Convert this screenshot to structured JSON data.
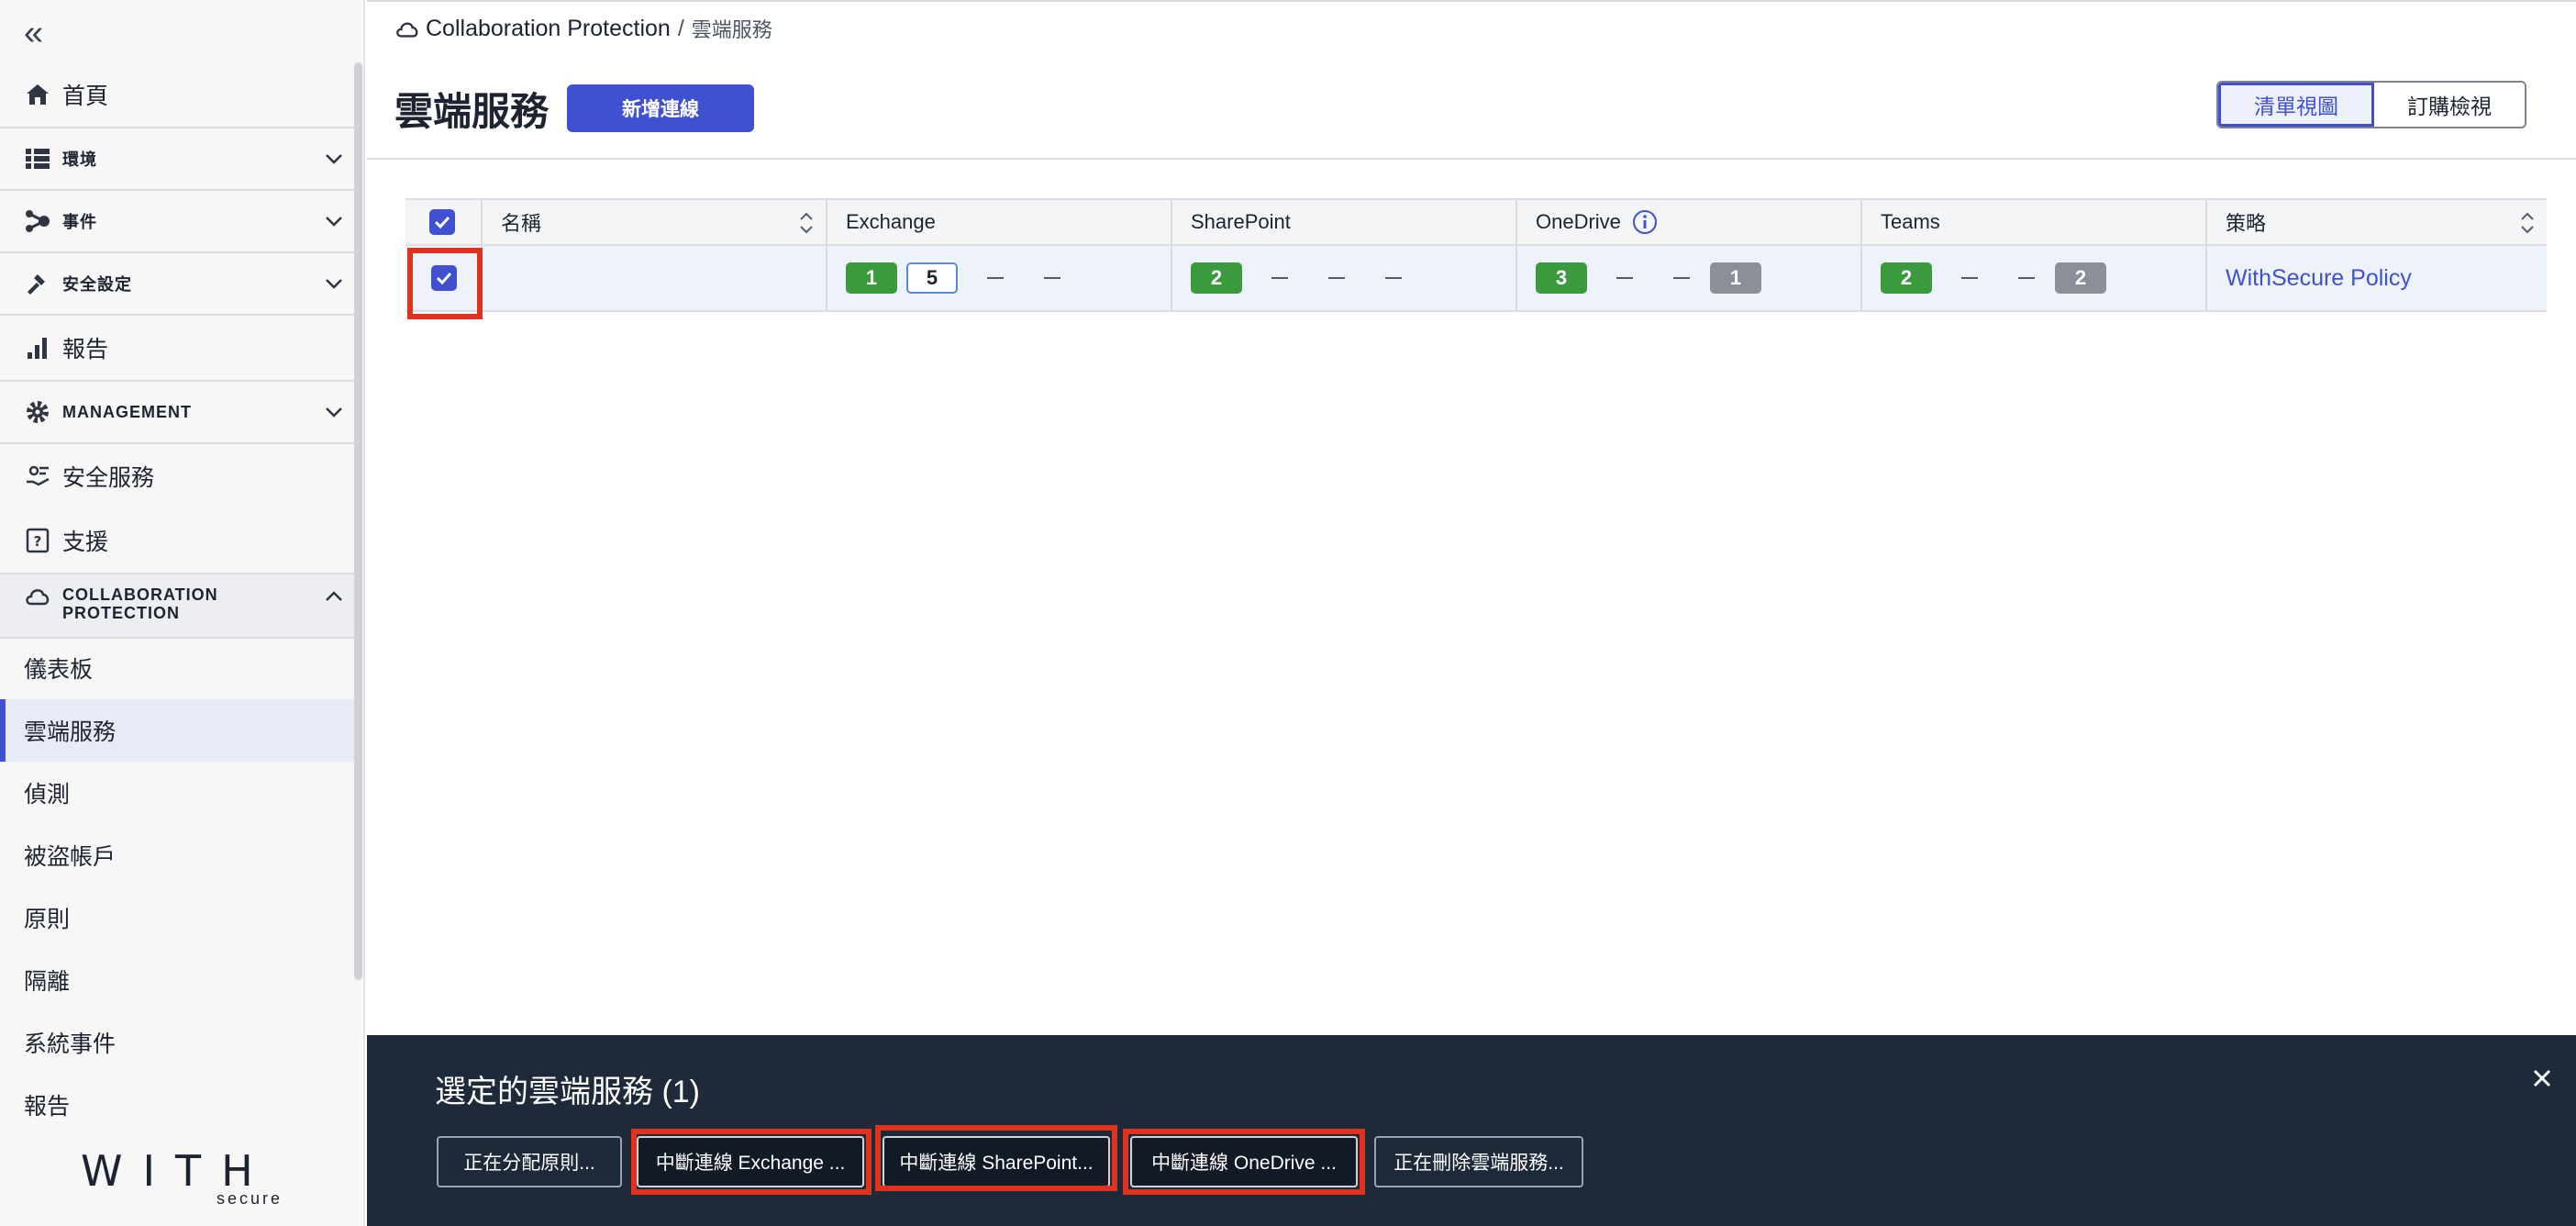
{
  "sidebar": {
    "items": [
      {
        "label": "首頁"
      },
      {
        "label": "環境"
      },
      {
        "label": "事件"
      },
      {
        "label": "安全設定"
      },
      {
        "label": "報告"
      },
      {
        "label": "MANAGEMENT"
      },
      {
        "label": "安全服務"
      },
      {
        "label": "支援"
      },
      {
        "label": "COLLABORATION PROTECTION"
      }
    ],
    "subitems": [
      {
        "label": "儀表板"
      },
      {
        "label": "雲端服務"
      },
      {
        "label": "偵測"
      },
      {
        "label": "被盜帳戶"
      },
      {
        "label": "原則"
      },
      {
        "label": "隔離"
      },
      {
        "label": "系統事件"
      },
      {
        "label": "報告"
      }
    ],
    "logo_text": "WITH",
    "logo_sub": "secure"
  },
  "breadcrumb": {
    "root": "Collaboration Protection",
    "separator": "/",
    "current": "雲端服務"
  },
  "page": {
    "title": "雲端服務",
    "add_button": "新增連線",
    "view_list": "清單視圖",
    "view_subscription": "訂購檢視"
  },
  "table": {
    "headers": {
      "name": "名稱",
      "exchange": "Exchange",
      "sharepoint": "SharePoint",
      "onedrive": "OneDrive",
      "teams": "Teams",
      "policy": "策略"
    },
    "row": {
      "name": "",
      "exchange": {
        "green": "1",
        "outline": "5"
      },
      "sharepoint": {
        "green": "2"
      },
      "onedrive": {
        "green": "3",
        "grey": "1"
      },
      "teams": {
        "green": "2",
        "grey": "2"
      },
      "policy": "WithSecure Policy"
    }
  },
  "actionbar": {
    "title": "選定的雲端服務 (1)",
    "buttons": [
      {
        "label": "正在分配原則..."
      },
      {
        "label": "中斷連線 Exchange ..."
      },
      {
        "label": "中斷連線 SharePoint..."
      },
      {
        "label": "中斷連線 OneDrive ..."
      },
      {
        "label": "正在刪除雲端服務..."
      }
    ]
  },
  "colors": {
    "accent": "#3f51d1",
    "highlight": "#e0331e",
    "green": "#3a9a3e",
    "grey": "#8b8f98",
    "actionbar_bg": "#1e2a3a"
  }
}
